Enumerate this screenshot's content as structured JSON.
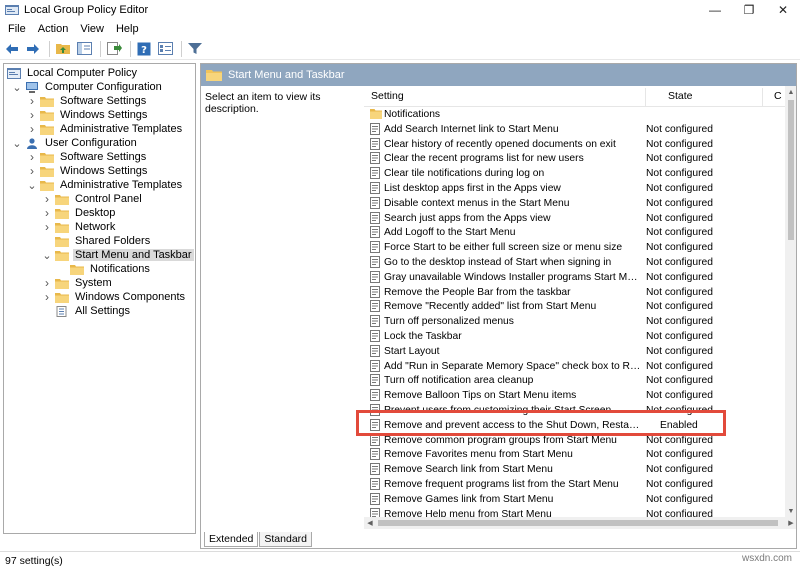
{
  "window": {
    "title": "Local Group Policy Editor",
    "controls": {
      "minimize": "—",
      "maximize": "❐",
      "close": "✕"
    }
  },
  "menu": [
    "File",
    "Action",
    "View",
    "Help"
  ],
  "toolbar_icons": [
    "back-icon",
    "forward-icon",
    "up-folder-icon",
    "show-hide-tree-icon",
    "export-list-icon",
    "help-icon",
    "properties-icon",
    "filter-icon"
  ],
  "tree": {
    "root": "Local Computer Policy",
    "items": [
      {
        "label": "Computer Configuration",
        "chevron": "expanded",
        "icon": "computer"
      },
      {
        "label": "Software Settings",
        "chevron": "collapsed",
        "icon": "folder"
      },
      {
        "label": "Windows Settings",
        "chevron": "collapsed",
        "icon": "folder"
      },
      {
        "label": "Administrative Templates",
        "chevron": "collapsed",
        "icon": "folder"
      },
      {
        "label": "User Configuration",
        "chevron": "expanded",
        "icon": "user"
      },
      {
        "label": "Software Settings",
        "chevron": "collapsed",
        "icon": "folder"
      },
      {
        "label": "Windows Settings",
        "chevron": "collapsed",
        "icon": "folder"
      },
      {
        "label": "Administrative Templates",
        "chevron": "expanded",
        "icon": "folder"
      },
      {
        "label": "Control Panel",
        "chevron": "collapsed",
        "icon": "folder"
      },
      {
        "label": "Desktop",
        "chevron": "collapsed",
        "icon": "folder"
      },
      {
        "label": "Network",
        "chevron": "collapsed",
        "icon": "folder"
      },
      {
        "label": "Shared Folders",
        "chevron": "none",
        "icon": "folder"
      },
      {
        "label": "Start Menu and Taskbar",
        "chevron": "expanded",
        "icon": "folder",
        "selected": true
      },
      {
        "label": "Notifications",
        "chevron": "none",
        "icon": "folder"
      },
      {
        "label": "System",
        "chevron": "collapsed",
        "icon": "folder"
      },
      {
        "label": "Windows Components",
        "chevron": "collapsed",
        "icon": "folder"
      },
      {
        "label": "All Settings",
        "chevron": "none",
        "icon": "allsettings"
      }
    ]
  },
  "right_pane": {
    "header": "Start Menu and Taskbar",
    "description": "Select an item to view its description.",
    "columns": {
      "setting": "Setting",
      "state": "State",
      "comment": "C"
    },
    "rows": [
      {
        "name": "Notifications",
        "state": "",
        "type": "folder"
      },
      {
        "name": "Add Search Internet link to Start Menu",
        "state": "Not configured"
      },
      {
        "name": "Clear history of recently opened documents on exit",
        "state": "Not configured"
      },
      {
        "name": "Clear the recent programs list for new users",
        "state": "Not configured"
      },
      {
        "name": "Clear tile notifications during log on",
        "state": "Not configured"
      },
      {
        "name": "List desktop apps first in the Apps view",
        "state": "Not configured"
      },
      {
        "name": "Disable context menus in the Start Menu",
        "state": "Not configured"
      },
      {
        "name": "Search just apps from the Apps view",
        "state": "Not configured"
      },
      {
        "name": "Add Logoff to the Start Menu",
        "state": "Not configured"
      },
      {
        "name": "Force Start to be either full screen size or menu size",
        "state": "Not configured"
      },
      {
        "name": "Go to the desktop instead of Start when signing in",
        "state": "Not configured"
      },
      {
        "name": "Gray unavailable Windows Installer programs Start Menu sh...",
        "state": "Not configured"
      },
      {
        "name": "Remove the People Bar from the taskbar",
        "state": "Not configured"
      },
      {
        "name": "Remove \"Recently added\" list from Start Menu",
        "state": "Not configured"
      },
      {
        "name": "Turn off personalized menus",
        "state": "Not configured"
      },
      {
        "name": "Lock the Taskbar",
        "state": "Not configured"
      },
      {
        "name": "Start Layout",
        "state": "Not configured"
      },
      {
        "name": "Add \"Run in Separate Memory Space\" check box to Run dial...",
        "state": "Not configured"
      },
      {
        "name": "Turn off notification area cleanup",
        "state": "Not configured"
      },
      {
        "name": "Remove Balloon Tips on Start Menu items",
        "state": "Not configured"
      },
      {
        "name": "Prevent users from customizing their Start Screen",
        "state": "Not configured"
      },
      {
        "name": "Remove and prevent access to the Shut Down, Restart, Sleep...",
        "state": "Enabled",
        "highlighted": true
      },
      {
        "name": "Remove common program groups from Start Menu",
        "state": "Not configured"
      },
      {
        "name": "Remove Favorites menu from Start Menu",
        "state": "Not configured"
      },
      {
        "name": "Remove Search link from Start Menu",
        "state": "Not configured"
      },
      {
        "name": "Remove frequent programs list from the Start Menu",
        "state": "Not configured"
      },
      {
        "name": "Remove Games link from Start Menu",
        "state": "Not configured"
      },
      {
        "name": "Remove Help menu from Start Menu",
        "state": "Not configured"
      }
    ]
  },
  "tabs": [
    "Extended",
    "Standard"
  ],
  "status": "97 setting(s)",
  "watermark": "wsxdn.com",
  "colors": {
    "header_bg": "#8fa6bf",
    "highlight_border": "#e24a3b",
    "folder": "#f2c45a"
  }
}
